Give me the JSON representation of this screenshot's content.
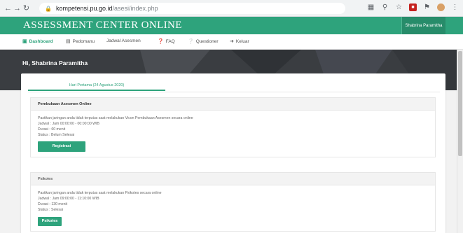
{
  "browser": {
    "url_host": "kompetensi.pu.go.id",
    "url_path": "/asesi/index.php",
    "extensions": [
      "translate-icon",
      "zoom-icon",
      "star-icon",
      "red-ext-icon",
      "puzzle-icon",
      "profile-avatar-icon",
      "kebab-menu-icon"
    ]
  },
  "header": {
    "brand": "ASSESSMENT CENTER ONLINE",
    "user": "Shabrina Paramitha"
  },
  "menu": {
    "items": [
      {
        "label": "Dashboard",
        "icon": "dashboard-icon"
      },
      {
        "label": "Pedomanu",
        "icon": "book-icon"
      },
      {
        "label": "Jadwal Asesmen",
        "icon": ""
      },
      {
        "label": "FAQ",
        "icon": "help-icon"
      },
      {
        "label": "Questioner",
        "icon": "question-icon"
      },
      {
        "label": "Keluar",
        "icon": "logout-icon"
      }
    ]
  },
  "banner": {
    "greeting": "Hi, Shabrina Paramitha"
  },
  "tab": {
    "label": "Hari Pertama (24 Agustus 2020)"
  },
  "panels": [
    {
      "title": "Pembukaan Asesmen Online",
      "lines": [
        "Pastikan jaringan anda tidak terputus saat melakukan Vicon Pembukaan Asesmen secara online",
        "Jadwal : Jam 00:00:00 - 00:00:00 WIB",
        "Durasi : 60 menit",
        "Status : Belum Selesai"
      ],
      "button": "Registrasi"
    },
    {
      "title": "Psikotes",
      "lines": [
        "Pastikan jaringan anda tidak terputus saat melakukan Psikotes secara online",
        "Jadwal : Jam 09:00:00 - 11:10:00 WIB",
        "Durasi : 130 menit",
        "Status : Selesai"
      ],
      "button": "Psikotes"
    }
  ],
  "colors": {
    "accent": "#2ea37c",
    "banner": "#3a3d41"
  }
}
